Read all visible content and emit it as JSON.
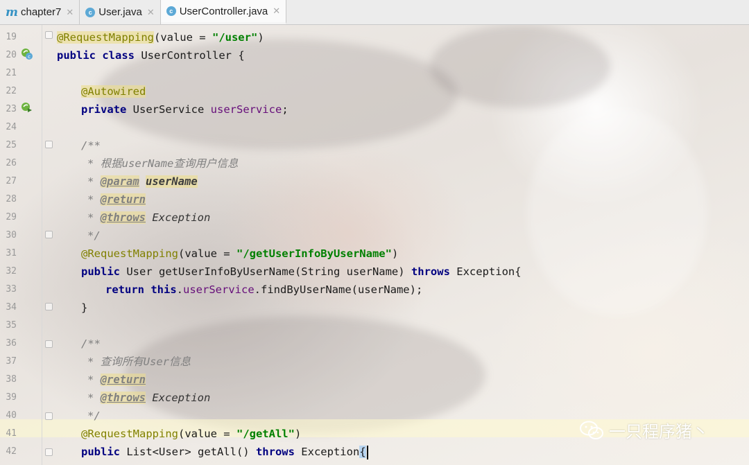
{
  "tabs": [
    {
      "label": "chapter7",
      "icon": "maven-module-icon",
      "active": false
    },
    {
      "label": "User.java",
      "icon": "class-icon",
      "active": false
    },
    {
      "label": "UserController.java",
      "icon": "class-icon",
      "active": true
    }
  ],
  "line_numbers": [
    "19",
    "20",
    "21",
    "22",
    "23",
    "24",
    "25",
    "26",
    "27",
    "28",
    "29",
    "30",
    "31",
    "32",
    "33",
    "34",
    "35",
    "36",
    "37",
    "38",
    "39",
    "40",
    "41",
    "42"
  ],
  "code": {
    "l19": {
      "ann": "@RequestMapping",
      "open": "(value = ",
      "str": "\"/user\"",
      "close": ")"
    },
    "l20": {
      "kw1": "public",
      "kw2": "class",
      "name": " UserController {"
    },
    "l22": {
      "ann": "@Autowired"
    },
    "l23": {
      "kw": "private",
      "type": " UserService ",
      "field": "userService",
      "end": ";"
    },
    "l25": {
      "text": "/**"
    },
    "l26": {
      "text": "* 根据userName查询用户信息"
    },
    "l27": {
      "star": "* ",
      "tag": "@param",
      "space": " ",
      "param": "userName"
    },
    "l28": {
      "star": "* ",
      "tag": "@return"
    },
    "l29": {
      "star": "* ",
      "tag": "@throws",
      "rest": " Exception"
    },
    "l30": {
      "text": "*/"
    },
    "l31": {
      "ann": "@RequestMapping",
      "open": "(value = ",
      "str": "\"/getUserInfoByUserName\"",
      "close": ")"
    },
    "l32": {
      "kw": "public",
      "sig": " User getUserInfoByUserName(String userName) ",
      "throws": "throws",
      "rest": " Exception{"
    },
    "l33": {
      "kw1": "return",
      "kw2": "this",
      "dot": ".",
      "field": "userService",
      "rest": ".findByUserName(userName);"
    },
    "l34": {
      "text": "}"
    },
    "l36": {
      "text": "/**"
    },
    "l37": {
      "text": "* 查询所有User信息"
    },
    "l38": {
      "star": "* ",
      "tag": "@return"
    },
    "l39": {
      "star": "* ",
      "tag": "@throws",
      "rest": " Exception"
    },
    "l40": {
      "text": "*/"
    },
    "l41": {
      "ann": "@RequestMapping",
      "open": "(value = ",
      "str": "\"/getAll\"",
      "close": ")"
    },
    "l42": {
      "kw": "public",
      "sig": " List<User> getAll() ",
      "throws": "throws",
      "rest": " Exception",
      "brace": "{"
    }
  },
  "watermark": {
    "text": "一只程序猪丶",
    "icon": "wechat-icon"
  },
  "colors": {
    "keyword": "#000080",
    "annotation": "#808000",
    "string": "#008000",
    "field": "#660e7a",
    "comment": "#808080"
  }
}
